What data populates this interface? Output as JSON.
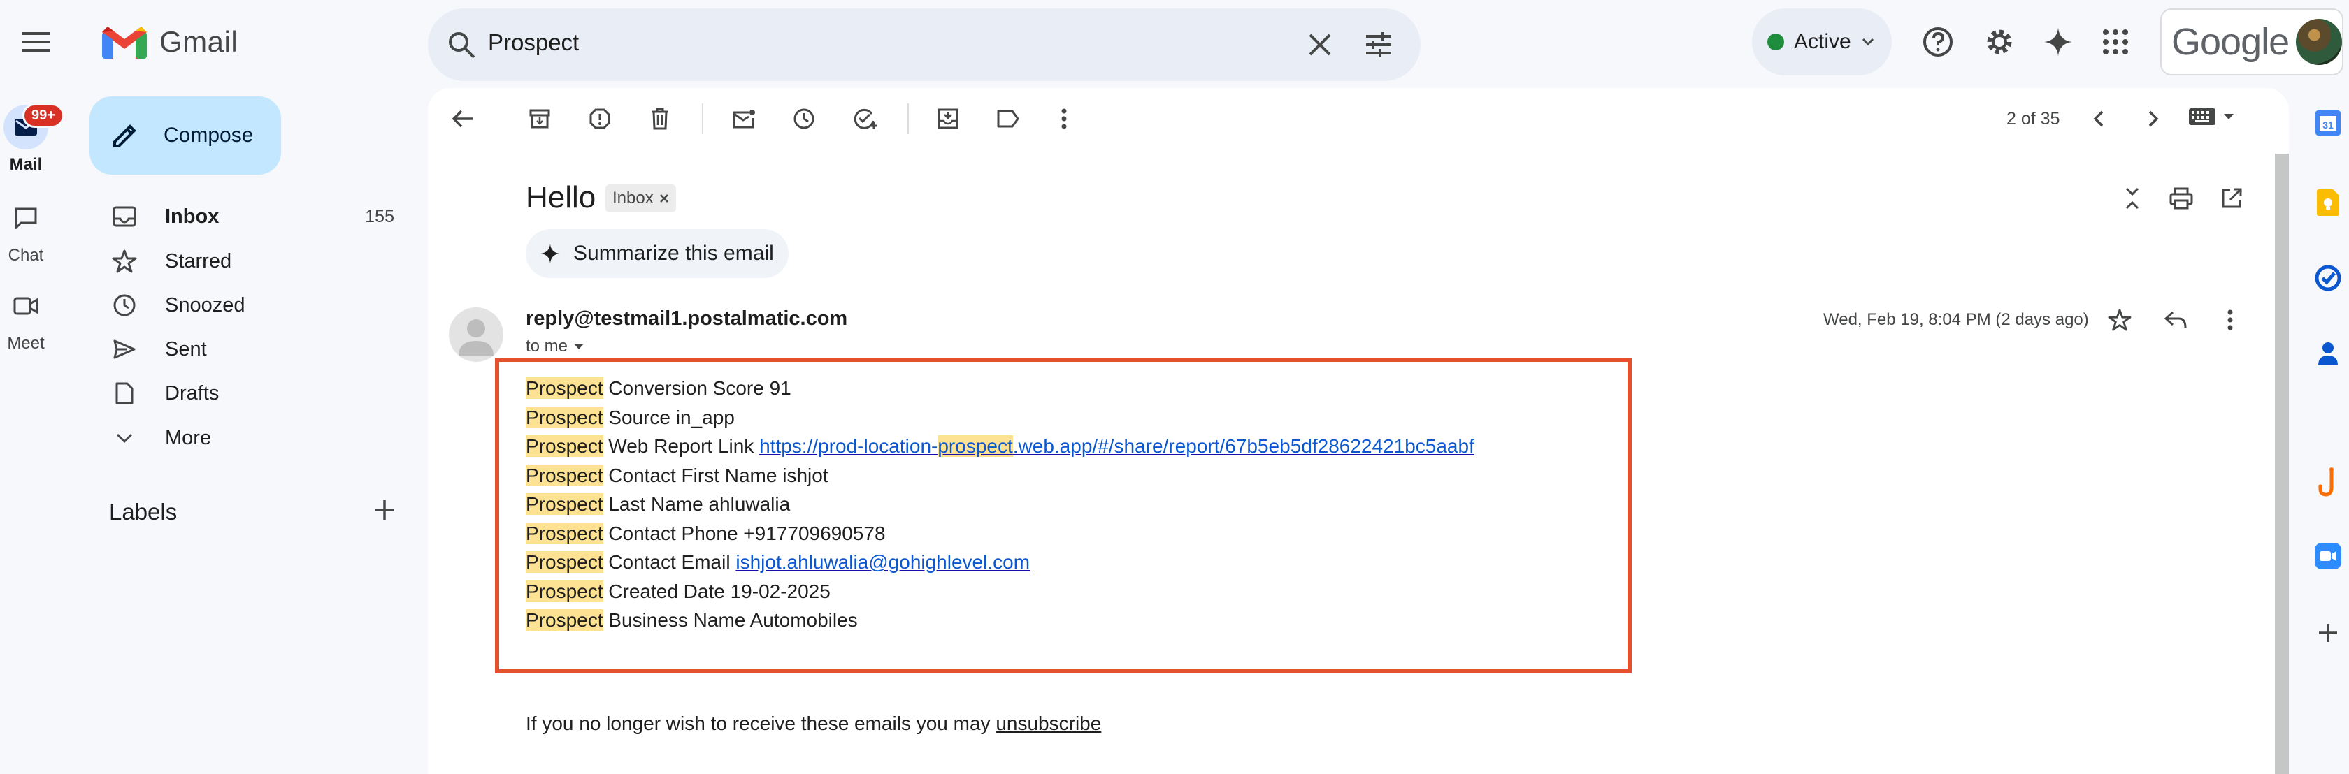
{
  "app": {
    "name": "Gmail"
  },
  "search": {
    "value": "Prospect"
  },
  "status": {
    "label": "Active"
  },
  "account": {
    "brand": "Google"
  },
  "rail": [
    {
      "label": "Mail",
      "badge": "99+"
    },
    {
      "label": "Chat"
    },
    {
      "label": "Meet"
    }
  ],
  "compose": {
    "label": "Compose"
  },
  "nav": [
    {
      "label": "Inbox",
      "count": "155",
      "icon": "inbox-icon"
    },
    {
      "label": "Starred",
      "icon": "star-icon"
    },
    {
      "label": "Snoozed",
      "icon": "clock-icon"
    },
    {
      "label": "Sent",
      "icon": "send-icon"
    },
    {
      "label": "Drafts",
      "icon": "draft-icon"
    },
    {
      "label": "More",
      "icon": "chevron-down-icon"
    }
  ],
  "labels": {
    "title": "Labels"
  },
  "pager": {
    "text": "2 of 35"
  },
  "email": {
    "subject": "Hello",
    "label_chip": "Inbox",
    "summarize": "Summarize this email",
    "sender": "reply@testmail1.postalmatic.com",
    "to": "to me",
    "date": "Wed, Feb 19, 8:04 PM (2 days ago)",
    "body": [
      {
        "key": "Prospect",
        "text": " Conversion Score 91"
      },
      {
        "key": "Prospect",
        "text": " Source in_app"
      },
      {
        "key": "Prospect",
        "text": " Web Report Link ",
        "link_pre": "https://prod-location-",
        "link_hl": "prospect",
        "link_post": ".web.app/#/share/report/67b5eb5df28622421bc5aabf"
      },
      {
        "key": "Prospect",
        "text": " Contact First Name ishjot"
      },
      {
        "key": "Prospect",
        "text": " Last Name ahluwalia"
      },
      {
        "key": "Prospect",
        "text": " Contact Phone +917709690578"
      },
      {
        "key": "Prospect",
        "text": " Contact Email ",
        "link": "ishjot.ahluwalia@gohighlevel.com"
      },
      {
        "key": "Prospect",
        "text": " Created Date 19-02-2025"
      },
      {
        "key": "Prospect",
        "text": " Business Name Automobiles"
      }
    ],
    "footer_text": "If you no longer wish to receive these emails you may ",
    "footer_link": "unsubscribe"
  },
  "colors": {
    "highlight_box": "#e5512c",
    "term_highlight": "#fde293",
    "compose_bg": "#c2e7ff"
  }
}
